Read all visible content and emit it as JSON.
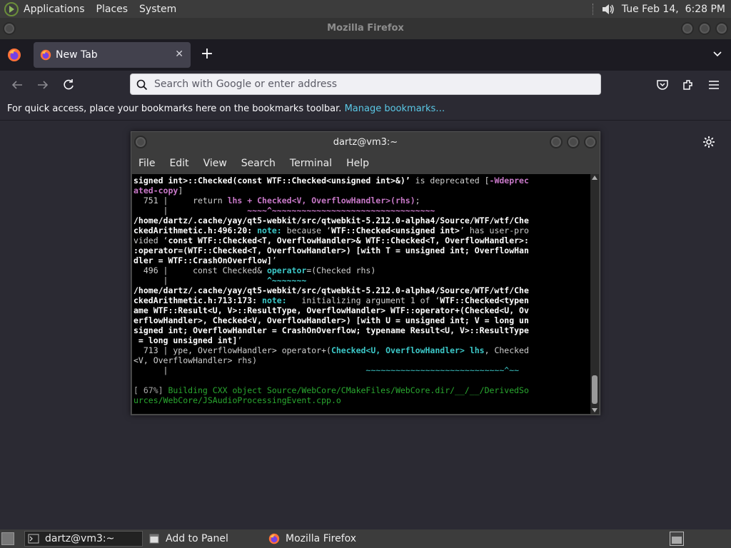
{
  "top_panel": {
    "menus": [
      "Applications",
      "Places",
      "System"
    ],
    "clock": "Tue Feb 14,  6:28 PM"
  },
  "firefox": {
    "window_title": "Mozilla Firefox",
    "tab_label": "New Tab",
    "tab_close": "✕",
    "new_tab": "+",
    "url_placeholder": "Search with Google or enter address",
    "bookmarks_text": "For quick access, place your bookmarks here on the bookmarks toolbar.",
    "manage_bookmarks": "Manage bookmarks…"
  },
  "terminal": {
    "title": "dartz@vm3:~",
    "menus": [
      "File",
      "Edit",
      "View",
      "Search",
      "Terminal",
      "Help"
    ],
    "lines": [
      [
        {
          "t": "signed int>::Checked(const WTF::Checked<unsigned int>&)’",
          "c": "b"
        },
        {
          "t": " is deprecated [",
          "c": ""
        },
        {
          "t": "-Wdeprec",
          "c": "mag"
        }
      ],
      [
        {
          "t": "ated-copy",
          "c": "mag"
        },
        {
          "t": "]",
          "c": ""
        }
      ],
      [
        {
          "t": "  751 |     return ",
          "c": ""
        },
        {
          "t": "lhs + Checked<V, OverflowHandler>(rhs)",
          "c": "mag"
        },
        {
          "t": ";",
          "c": ""
        }
      ],
      [
        {
          "t": "      |                ",
          "c": ""
        },
        {
          "t": "~~~~^~~~~~~~~~~~~~~~~~~~~~~~~~~~~~~~~~",
          "c": "mag"
        }
      ],
      [
        {
          "t": "/home/dartz/.cache/yay/qt5-webkit/src/qtwebkit-5.212.0-alpha4/Source/WTF/wtf/Che",
          "c": "b"
        }
      ],
      [
        {
          "t": "ckedArithmetic.h:496:20: ",
          "c": "b"
        },
        {
          "t": "note:",
          "c": "cy"
        },
        {
          "t": " because ‘",
          "c": ""
        },
        {
          "t": "WTF::Checked<unsigned int>",
          "c": "b"
        },
        {
          "t": "’ has user-pro",
          "c": ""
        }
      ],
      [
        {
          "t": "vided ‘",
          "c": ""
        },
        {
          "t": "const WTF::Checked<T, OverflowHandler>& WTF::Checked<T, OverflowHandler>:",
          "c": "b"
        }
      ],
      [
        {
          "t": ":operator=(WTF::Checked<T, OverflowHandler>) [with T = unsigned int; OverflowHan",
          "c": "b"
        }
      ],
      [
        {
          "t": "dler = WTF::CrashOnOverflow]",
          "c": "b"
        },
        {
          "t": "’",
          "c": ""
        }
      ],
      [
        {
          "t": "  496 |     const Checked& ",
          "c": ""
        },
        {
          "t": "operator",
          "c": "cy"
        },
        {
          "t": "=(Checked rhs)",
          "c": ""
        }
      ],
      [
        {
          "t": "      |                    ",
          "c": ""
        },
        {
          "t": "^~~~~~~~",
          "c": "cy"
        }
      ],
      [
        {
          "t": "/home/dartz/.cache/yay/qt5-webkit/src/qtwebkit-5.212.0-alpha4/Source/WTF/wtf/Che",
          "c": "b"
        }
      ],
      [
        {
          "t": "ckedArithmetic.h:713:173: ",
          "c": "b"
        },
        {
          "t": "note:",
          "c": "cy"
        },
        {
          "t": "   initializing argument 1 of ‘",
          "c": ""
        },
        {
          "t": "WTF::Checked<typen",
          "c": "b"
        }
      ],
      [
        {
          "t": "ame WTF::Result<U, V>::ResultType, OverflowHandler> WTF::operator+(Checked<U, Ov",
          "c": "b"
        }
      ],
      [
        {
          "t": "erflowHandler>, Checked<V, OverflowHandler>) [with U = unsigned int; V = long un",
          "c": "b"
        }
      ],
      [
        {
          "t": "signed int; OverflowHandler = CrashOnOverflow; typename Result<U, V>::ResultType",
          "c": "b"
        }
      ],
      [
        {
          "t": " = long unsigned int]",
          "c": "b"
        },
        {
          "t": "’",
          "c": ""
        }
      ],
      [
        {
          "t": "  713 | ype, OverflowHandler> operator+(",
          "c": ""
        },
        {
          "t": "Checked<U, OverflowHandler> lhs",
          "c": "cy"
        },
        {
          "t": ", Checked",
          "c": ""
        }
      ],
      [
        {
          "t": "<V, OverflowHandler> rhs)",
          "c": ""
        }
      ],
      [
        {
          "t": "      |                                        ",
          "c": ""
        },
        {
          "t": "~~~~~~~~~~~~~~~~~~~~~~~~~~~~^~~",
          "c": "cyn"
        }
      ],
      [
        {
          "t": " ",
          "c": ""
        }
      ],
      [
        {
          "t": "[ 67%] ",
          "c": "gry"
        },
        {
          "t": "Building CXX object Source/WebCore/CMakeFiles/WebCore.dir/__/__/DerivedSo",
          "c": "grn"
        }
      ],
      [
        {
          "t": "urces/WebCore/JSAudioProcessingEvent.cpp.o",
          "c": "grn"
        }
      ]
    ]
  },
  "taskbar": {
    "items": [
      "dartz@vm3:~",
      "Add to Panel",
      "Mozilla Firefox"
    ]
  }
}
